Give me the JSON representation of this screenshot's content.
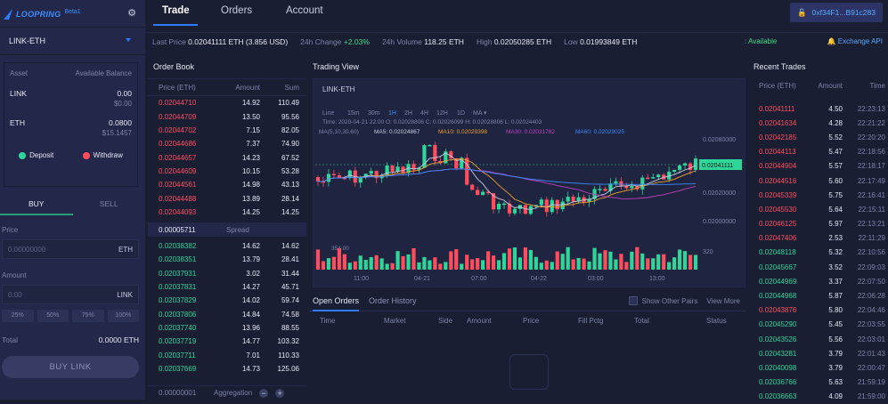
{
  "app": {
    "logo_text": "LOOPRING",
    "beta": "Beta1"
  },
  "market": {
    "pair": "LINK-ETH"
  },
  "balances": {
    "header_asset": "Asset",
    "header_balance": "Available Balance",
    "rows": [
      {
        "asset": "LINK",
        "amount": "0.00",
        "usd": "$0.00"
      },
      {
        "asset": "ETH",
        "amount": "0.0800",
        "usd": "$15.1457"
      }
    ],
    "deposit": "Deposit",
    "withdraw": "Withdraw"
  },
  "trade_form": {
    "buy_tab": "BUY",
    "sell_tab": "SELL",
    "price_label": "Price",
    "price_placeholder": "0.00000000",
    "price_unit": "ETH",
    "amount_label": "Amount",
    "amount_placeholder": "0.00",
    "amount_unit": "LINK",
    "percents": [
      "25%",
      "50%",
      "75%",
      "100%"
    ],
    "total_label": "Total",
    "total_value": "0.0000 ETH",
    "buy_button": "BUY LINK"
  },
  "nav": {
    "trade": "Trade",
    "orders": "Orders",
    "account": "Account",
    "wallet": "0xf34F1...B91c283"
  },
  "stats": {
    "last_price_label": "Last Price",
    "last_price": "0.02041111 ETH (3.856 USD)",
    "change_label": "24h Change",
    "change": "+2.03%",
    "volume_label": "24h Volume",
    "volume": "118.25 ETH",
    "high_label": "High",
    "high": "0.02050285 ETH",
    "low_label": "Low",
    "low": "0.01993849 ETH",
    "available": "Available",
    "exchange_api": "Exchange API"
  },
  "order_book": {
    "title": "Order Book",
    "columns": [
      "Price (ETH)",
      "Amount",
      "Sum"
    ],
    "asks": [
      [
        "0.02044710",
        "14.92",
        "110.49"
      ],
      [
        "0.02044709",
        "13.50",
        "95.56"
      ],
      [
        "0.02044702",
        "7.15",
        "82.05"
      ],
      [
        "0.02044686",
        "7.37",
        "74.90"
      ],
      [
        "0.02044657",
        "14.23",
        "67.52"
      ],
      [
        "0.02044609",
        "10.15",
        "53.28"
      ],
      [
        "0.02044561",
        "14.98",
        "43.13"
      ],
      [
        "0.02044488",
        "13.89",
        "28.14"
      ],
      [
        "0.02044093",
        "14.25",
        "14.25"
      ]
    ],
    "spread_value": "0.00005711",
    "spread_label": "Spread",
    "bids": [
      [
        "0.02038382",
        "14.62",
        "14.62"
      ],
      [
        "0.02038351",
        "13.79",
        "28.41"
      ],
      [
        "0.02037931",
        "3.02",
        "31.44"
      ],
      [
        "0.02037831",
        "14.27",
        "45.71"
      ],
      [
        "0.02037829",
        "14.02",
        "59.74"
      ],
      [
        "0.02037806",
        "14.84",
        "74.58"
      ],
      [
        "0.02037740",
        "13.96",
        "88.55"
      ],
      [
        "0.02037719",
        "14.77",
        "103.32"
      ],
      [
        "0.02037711",
        "7.01",
        "110.33"
      ],
      [
        "0.02037669",
        "14.73",
        "125.06"
      ]
    ],
    "aggregation_value": "0.00000001",
    "aggregation_label": "Aggregation"
  },
  "trading_view": {
    "title": "Trading View",
    "pair": "LINK-ETH",
    "intervals": [
      "Line",
      "15m",
      "30m",
      "1H",
      "2H",
      "4H",
      "12H",
      "1D",
      "MA ▾"
    ],
    "active_interval": "1H",
    "ohlc": "Time: 2020-04-21 22:00   O: 0.02028806   C: 0.02026099   H: 0.02028806   L: 0.02024403",
    "ma_config": "MA(5,10,30,60)",
    "ma_labels": [
      {
        "text": "MA5: 0.02024867",
        "color": "#c9cde0"
      },
      {
        "text": "MA10: 0.02029398",
        "color": "#f0a030"
      },
      {
        "text": "MA30: 0.02031782",
        "color": "#c040c0"
      },
      {
        "text": "MA60: 0.02029025",
        "color": "#3b8cff"
      }
    ],
    "y_ticks": [
      "0.02080000",
      "0.02020000",
      "0.02000000"
    ],
    "current_price": "0.02041111",
    "volume_label": "354.00",
    "volume_tick": "320",
    "x_ticks": [
      "11:00",
      "04-21",
      "07:00",
      "04-22",
      "03:00",
      "13:00"
    ],
    "up_color": "#2fd69a",
    "down_color": "#ff4d5e"
  },
  "open_orders": {
    "tab_open": "Open Orders",
    "tab_history": "Order History",
    "show_other_pairs": "Show Other Pairs",
    "view_more": "View More",
    "columns": [
      "Time",
      "Market",
      "Side",
      "Amount",
      "Price",
      "Fill Pctg",
      "Total",
      "Status"
    ]
  },
  "recent_trades": {
    "title": "Recent Trades",
    "columns": [
      "Price (ETH)",
      "Amount",
      "Time"
    ],
    "rows": [
      [
        "0.02041111",
        "4.50",
        "22:23:13",
        "sell"
      ],
      [
        "0.02041634",
        "4.28",
        "22:21:22",
        "sell"
      ],
      [
        "0.02042185",
        "5.52",
        "22:20:20",
        "sell"
      ],
      [
        "0.02044113",
        "5.47",
        "22:18:56",
        "sell"
      ],
      [
        "0.02044904",
        "5.57",
        "22:18:17",
        "sell"
      ],
      [
        "0.02044516",
        "5.60",
        "22:17:49",
        "sell"
      ],
      [
        "0.02045339",
        "5.75",
        "22:16:41",
        "sell"
      ],
      [
        "0.02045530",
        "5.64",
        "22:15:11",
        "sell"
      ],
      [
        "0.02046125",
        "5.97",
        "22:13:21",
        "sell"
      ],
      [
        "0.02047406",
        "2.53",
        "22:11:29",
        "sell"
      ],
      [
        "0.02048118",
        "5.32",
        "22:10:56",
        "buy"
      ],
      [
        "0.02045667",
        "3.52",
        "22:09:03",
        "buy"
      ],
      [
        "0.02044969",
        "3.37",
        "22:07:50",
        "buy"
      ],
      [
        "0.02044968",
        "5.87",
        "22:06:28",
        "buy"
      ],
      [
        "0.02043876",
        "5.80",
        "22:04:46",
        "sell"
      ],
      [
        "0.02045290",
        "5.45",
        "22:03:55",
        "buy"
      ],
      [
        "0.02043526",
        "5.56",
        "22:03:01",
        "buy"
      ],
      [
        "0.02043281",
        "3.79",
        "22:01:43",
        "buy"
      ],
      [
        "0.02040098",
        "3.79",
        "22:00:47",
        "buy"
      ],
      [
        "0.02036766",
        "5.63",
        "21:59:19",
        "buy"
      ],
      [
        "0.02036663",
        "4.09",
        "21:59:00",
        "buy"
      ]
    ]
  }
}
